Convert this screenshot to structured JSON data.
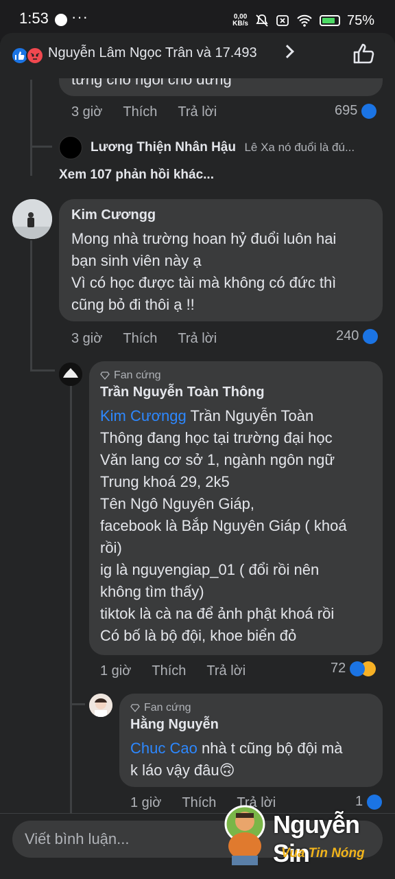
{
  "status_bar": {
    "time": "1:53",
    "dots": "···",
    "net_speed_value": "0,00",
    "net_speed_unit": "KB/s",
    "battery_pct": "75%"
  },
  "header": {
    "reaction_summary": "Nguyễn Lâm Ngọc Trân và 17.493",
    "reactions": [
      "like",
      "angry"
    ]
  },
  "comments": [
    {
      "partial_text": "từng cho ngồi cho đứng",
      "time": "3 giờ",
      "like_label": "Thích",
      "reply_label": "Trả lời",
      "count": "695"
    }
  ],
  "reply_preview": {
    "name": "Lương Thiện Nhân Hậu",
    "text": "Lê Xa nó đuổi là đú..."
  },
  "more_replies": "Xem 107 phản hồi khác...",
  "comment2": {
    "name": "Kim Cươngg",
    "lines": [
      "Mong nhà trường hoan hỷ đuổi luôn hai",
      "bạn sinh viên này ạ",
      "Vì có học được tài mà không có đức thì",
      "cũng bỏ đi thôi ạ !!"
    ],
    "time": "3 giờ",
    "like_label": "Thích",
    "reply_label": "Trả lời",
    "count": "240"
  },
  "reply1": {
    "badge": "Fan cứng",
    "name": "Trần Nguyễn Toàn Thông",
    "mention": "Kim Cươngg",
    "first_line_rest": " Trần Nguyễn Toàn",
    "lines": [
      "Thông đang học tại trường đại học",
      "Văn lang cơ sở 1, ngành ngôn ngữ",
      "Trung khoá 29, 2k5",
      "Tên Ngô Nguyên Giáp,",
      "facebook là Bắp Nguyên Giáp ( khoá",
      "rồi)",
      "ig là nguyengiap_01 ( đổi rồi nên",
      "không tìm thấy)",
      "tiktok là cà na để ảnh phật khoá rồi",
      "Có bố là bộ đội, khoe biển đỏ"
    ],
    "time": "1 giờ",
    "like_label": "Thích",
    "reply_label": "Trả lời",
    "count": "72"
  },
  "reply2": {
    "badge": "Fan cứng",
    "name": "Hằng Nguyễn",
    "mention": "Chuc Cao",
    "line1_rest": " nhà t cũng bộ đội mà",
    "line2": "k láo vậy đâu🙃",
    "time": "1 giờ",
    "like_label": "Thích",
    "reply_label": "Trả lời",
    "count": "1"
  },
  "composer": {
    "placeholder": "Viết bình luận..."
  },
  "watermark": {
    "title": "Nguyễn Sin",
    "subtitle": "Vua Tin Nóng"
  },
  "colors": {
    "accent": "#2d88ff",
    "like": "#1b74e4",
    "angry": "#f0484f",
    "bubble": "#3a3b3c",
    "watermark_gold": "#f2b51b"
  }
}
